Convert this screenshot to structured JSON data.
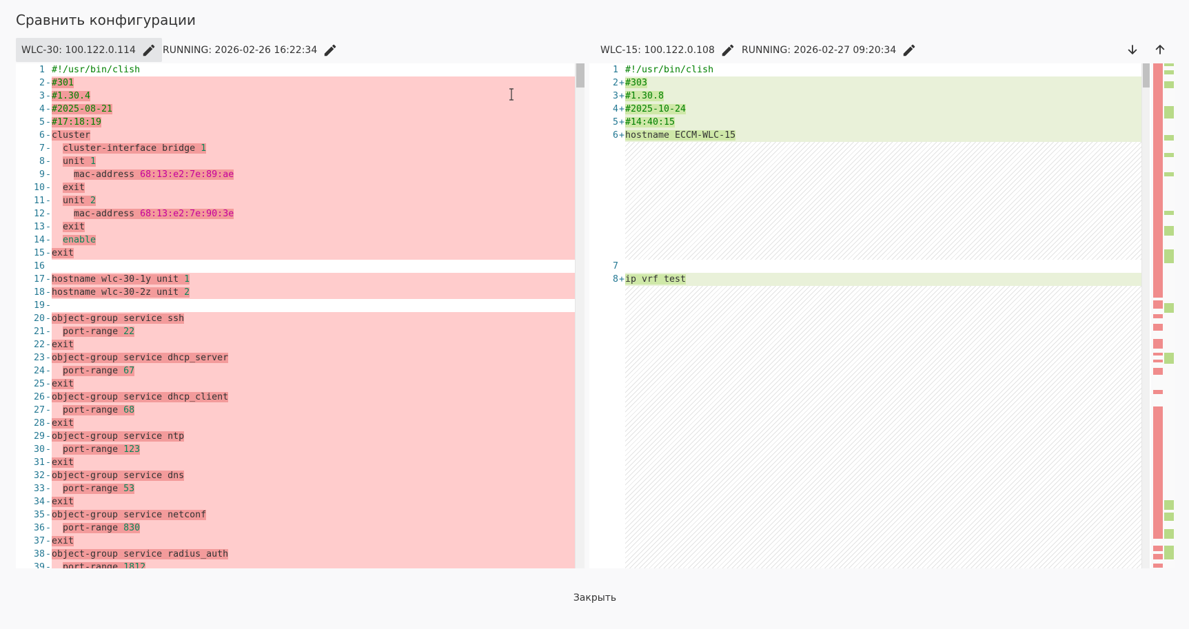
{
  "title": "Сравнить конфигурации",
  "left_header": {
    "device": "WLC-30: 100.122.0.114",
    "running": "RUNNING: 2026-02-26 16:22:34"
  },
  "right_header": {
    "device": "WLC-15: 100.122.0.108",
    "running": "RUNNING: 2026-02-27 09:20:34"
  },
  "icons": {
    "pencil": "pencil-icon",
    "next": "arrow-down-icon",
    "prev": "arrow-up-icon"
  },
  "left_lines": [
    {
      "n": "1",
      "mk": "",
      "t": "#!/usr/bin/clish",
      "kind": "ctx"
    },
    {
      "n": "2",
      "mk": "-",
      "t": "#301",
      "kind": "del"
    },
    {
      "n": "3",
      "mk": "-",
      "t": "#1.30.4",
      "kind": "del"
    },
    {
      "n": "4",
      "mk": "-",
      "t": "#2025-08-21",
      "kind": "del"
    },
    {
      "n": "5",
      "mk": "-",
      "t": "#17:18:19",
      "kind": "del"
    },
    {
      "n": "6",
      "mk": "-",
      "t": "cluster",
      "kind": "del"
    },
    {
      "n": "7",
      "mk": "-",
      "t": "  cluster-interface bridge 1",
      "kind": "del"
    },
    {
      "n": "8",
      "mk": "-",
      "t": "  unit 1",
      "kind": "del"
    },
    {
      "n": "9",
      "mk": "-",
      "t": "    mac-address 68:13:e2:7e:89:ae",
      "kind": "del"
    },
    {
      "n": "10",
      "mk": "-",
      "t": "  exit",
      "kind": "del"
    },
    {
      "n": "11",
      "mk": "-",
      "t": "  unit 2",
      "kind": "del"
    },
    {
      "n": "12",
      "mk": "-",
      "t": "    mac-address 68:13:e2:7e:90:3e",
      "kind": "del"
    },
    {
      "n": "13",
      "mk": "-",
      "t": "  exit",
      "kind": "del"
    },
    {
      "n": "14",
      "mk": "-",
      "t": "  enable",
      "kind": "del"
    },
    {
      "n": "15",
      "mk": "-",
      "t": "exit",
      "kind": "del"
    },
    {
      "n": "16",
      "mk": "",
      "t": "",
      "kind": "ctx"
    },
    {
      "n": "17",
      "mk": "-",
      "t": "hostname wlc-30-1y unit 1",
      "kind": "del"
    },
    {
      "n": "18",
      "mk": "-",
      "t": "hostname wlc-30-2z unit 2",
      "kind": "del"
    },
    {
      "n": "19",
      "mk": "-",
      "t": "",
      "kind": "del"
    },
    {
      "n": "20",
      "mk": "-",
      "t": "object-group service ssh",
      "kind": "del"
    },
    {
      "n": "21",
      "mk": "-",
      "t": "  port-range 22",
      "kind": "del"
    },
    {
      "n": "22",
      "mk": "-",
      "t": "exit",
      "kind": "del"
    },
    {
      "n": "23",
      "mk": "-",
      "t": "object-group service dhcp_server",
      "kind": "del"
    },
    {
      "n": "24",
      "mk": "-",
      "t": "  port-range 67",
      "kind": "del"
    },
    {
      "n": "25",
      "mk": "-",
      "t": "exit",
      "kind": "del"
    },
    {
      "n": "26",
      "mk": "-",
      "t": "object-group service dhcp_client",
      "kind": "del"
    },
    {
      "n": "27",
      "mk": "-",
      "t": "  port-range 68",
      "kind": "del"
    },
    {
      "n": "28",
      "mk": "-",
      "t": "exit",
      "kind": "del"
    },
    {
      "n": "29",
      "mk": "-",
      "t": "object-group service ntp",
      "kind": "del"
    },
    {
      "n": "30",
      "mk": "-",
      "t": "  port-range 123",
      "kind": "del"
    },
    {
      "n": "31",
      "mk": "-",
      "t": "exit",
      "kind": "del"
    },
    {
      "n": "32",
      "mk": "-",
      "t": "object-group service dns",
      "kind": "del"
    },
    {
      "n": "33",
      "mk": "-",
      "t": "  port-range 53",
      "kind": "del"
    },
    {
      "n": "34",
      "mk": "-",
      "t": "exit",
      "kind": "del"
    },
    {
      "n": "35",
      "mk": "-",
      "t": "object-group service netconf",
      "kind": "del"
    },
    {
      "n": "36",
      "mk": "-",
      "t": "  port-range 830",
      "kind": "del"
    },
    {
      "n": "37",
      "mk": "-",
      "t": "exit",
      "kind": "del"
    },
    {
      "n": "38",
      "mk": "-",
      "t": "object-group service radius_auth",
      "kind": "del"
    },
    {
      "n": "39",
      "mk": "-",
      "t": "  port-range 1812",
      "kind": "del"
    }
  ],
  "right_lines": [
    {
      "n": "1",
      "mk": "",
      "t": "#!/usr/bin/clish",
      "kind": "ctx",
      "row": 0
    },
    {
      "n": "2",
      "mk": "+",
      "t": "#303",
      "kind": "ins",
      "row": 1
    },
    {
      "n": "3",
      "mk": "+",
      "t": "#1.30.8",
      "kind": "ins",
      "row": 2
    },
    {
      "n": "4",
      "mk": "+",
      "t": "#2025-10-24",
      "kind": "ins",
      "row": 3
    },
    {
      "n": "5",
      "mk": "+",
      "t": "#14:40:15",
      "kind": "ins",
      "row": 4
    },
    {
      "n": "6",
      "mk": "+",
      "t": "hostname ECCM-WLC-15",
      "kind": "ins",
      "row": 5
    },
    {
      "n": "7",
      "mk": "",
      "t": "",
      "kind": "ctx",
      "row": 15
    },
    {
      "n": "8",
      "mk": "+",
      "t": "ip vrf test",
      "kind": "ins",
      "row": 16
    }
  ],
  "close_label": "Закрыть",
  "colors": {
    "deleted_line": "#ffcccc",
    "deleted_token": "#f39b9b",
    "inserted_line": "#e9f1d9",
    "inserted_token": "#cfe8a8",
    "line_number": "#237893"
  }
}
